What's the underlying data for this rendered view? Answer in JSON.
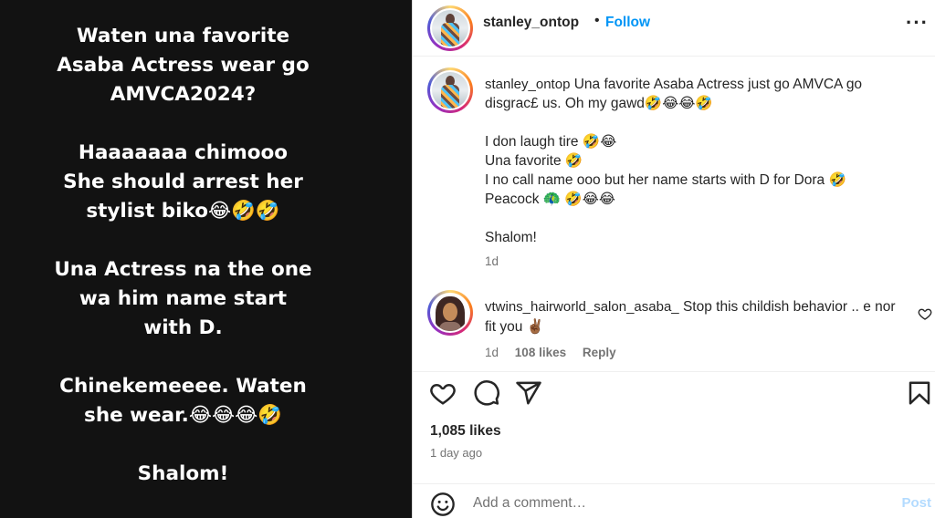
{
  "media": {
    "paragraphs": [
      [
        "Waten una favorite",
        "Asaba Actress wear go",
        "AMVCA2024?"
      ],
      [
        "Haaaaaaa chimooo",
        "She should arrest her",
        "stylist biko😂🤣🤣"
      ],
      [
        "Una Actress na the one",
        "wa him name start",
        "with D."
      ],
      [
        "Chinekemeeee. Waten",
        "she wear.😂😂😂🤣"
      ],
      [
        "Shalom!"
      ]
    ]
  },
  "header": {
    "username": "stanley_ontop",
    "dot": "•",
    "follow_label": "Follow",
    "more_label": "···"
  },
  "caption": {
    "username": "stanley_ontop",
    "text_first": "Una favorite Asaba Actress just go AMVCA go disgrac£ us. Oh my gawd🤣😂😂🤣",
    "line1": "I don laugh tire 🤣😂",
    "line2": "Una favorite 🤣",
    "line3": "I no call name ooo but her name starts with D for Dora 🤣 Peacock 🦚 🤣😂😂",
    "line4": "Shalom!",
    "time": "1d"
  },
  "comment": {
    "username": "vtwins_hairworld_salon_asaba_",
    "text": "Stop this childish behavior .. e nor fit you ✌🏾",
    "time": "1d",
    "likes": "108 likes",
    "reply_label": "Reply"
  },
  "actions": {
    "likes_count": "1,085 likes",
    "posted_ago": "1 day ago",
    "icons": [
      "heart-icon",
      "comment-icon",
      "share-icon",
      "bookmark-icon"
    ]
  },
  "add_comment": {
    "placeholder": "Add a comment…",
    "post_label": "Post"
  },
  "colors": {
    "media_bg": "#121212",
    "follow_blue": "#0095f6",
    "post_disabled": "#b3dbff",
    "secondary_text": "#737373"
  }
}
